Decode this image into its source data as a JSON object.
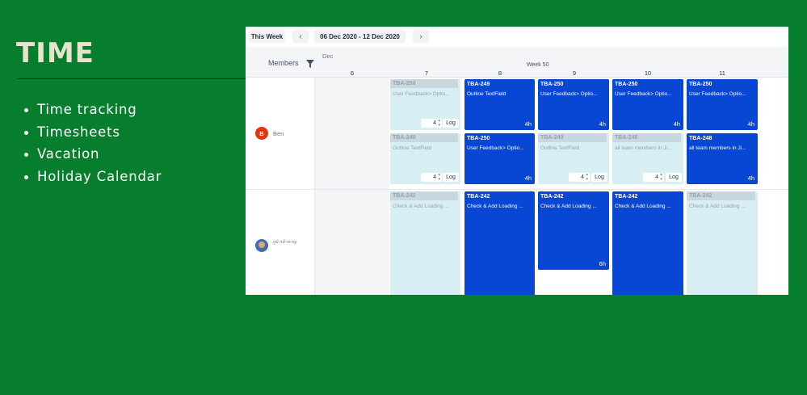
{
  "slide": {
    "title": "TIME",
    "bullets": [
      "Time tracking",
      "Timesheets",
      "Vacation",
      "Holiday Calendar"
    ]
  },
  "toolbar": {
    "this_week": "This Week",
    "prev": "‹",
    "date_range": "06 Dec 2020 - 12 Dec 2020",
    "next": "›"
  },
  "header": {
    "members_label": "Members",
    "month": "Dec",
    "week": "Week 50",
    "days": [
      "6",
      "7",
      "8",
      "9",
      "10",
      "11"
    ]
  },
  "members": [
    {
      "initial": "B",
      "name": "Ben"
    },
    {
      "name": "ภูมิ กล้าหาญ"
    }
  ],
  "cards": [
    {
      "key": "TBA-250",
      "summary": "User Feedback> Optio...",
      "log": "Log",
      "estimate": "4"
    },
    {
      "key": "TBA-249",
      "summary": "Outline TextField",
      "hours": "4h"
    },
    {
      "key": "TBA-250",
      "summary": "User Feedback> Optio...",
      "hours": "4h"
    },
    {
      "key": "TBA-250",
      "summary": "User Feedback> Optio...",
      "hours": "4h"
    },
    {
      "key": "TBA-250",
      "summary": "User Feedback> Optio...",
      "hours": "4h"
    },
    {
      "key": "TBA-249",
      "summary": "Outline TextField",
      "log": "Log",
      "estimate": "4"
    },
    {
      "key": "TBA-250",
      "summary": "User Feedback> Optio...",
      "hours": "4h"
    },
    {
      "key": "TBA-249",
      "summary": "Outline TextField",
      "log": "Log",
      "estimate": "4"
    },
    {
      "key": "TBA-248",
      "summary": "all team members in Ji...",
      "log": "Log",
      "estimate": "4"
    },
    {
      "key": "TBA-248",
      "summary": "all team members in Ji...",
      "hours": "4h"
    },
    {
      "key": "TBA-242",
      "summary": "Check & Add Loading ..."
    },
    {
      "key": "TBA-242",
      "summary": "Check & Add Loading ..."
    },
    {
      "key": "TBA-242",
      "summary": "Check & Add Loading ...",
      "hours": "6h"
    },
    {
      "key": "TBA-242",
      "summary": "Check & Add Loading ..."
    },
    {
      "key": "TBA-242",
      "summary": "Check & Add Loading ..."
    }
  ],
  "colors": {
    "background": "#067e2e",
    "card_dark": "#0747d4",
    "card_light": "#d7eef3",
    "title": "#e8e2cf"
  }
}
